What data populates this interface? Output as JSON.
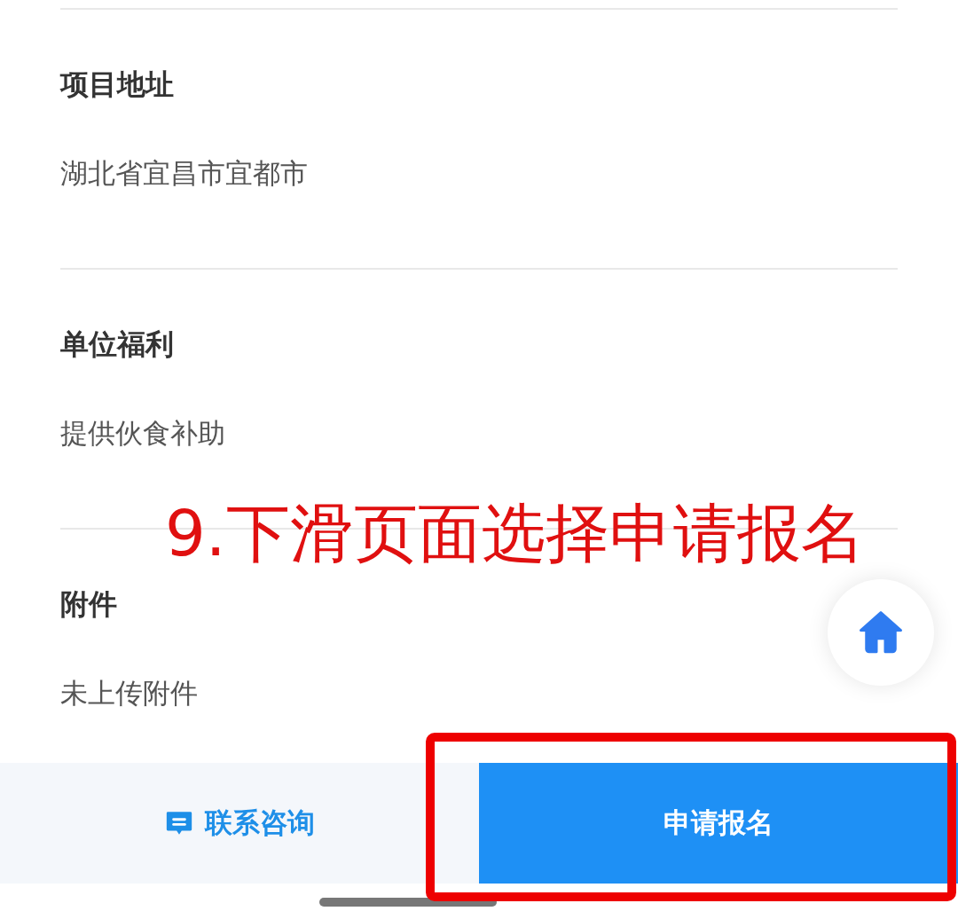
{
  "sections": [
    {
      "label": "项目地址",
      "value": "湖北省宜昌市宜都市"
    },
    {
      "label": "单位福利",
      "value": "提供伙食补助"
    },
    {
      "label": "附件",
      "value": "未上传附件"
    }
  ],
  "annotation": {
    "text": "9.下滑页面选择申请报名"
  },
  "bottom_bar": {
    "consult_button": "联系咨询",
    "apply_button": "申请报名"
  }
}
